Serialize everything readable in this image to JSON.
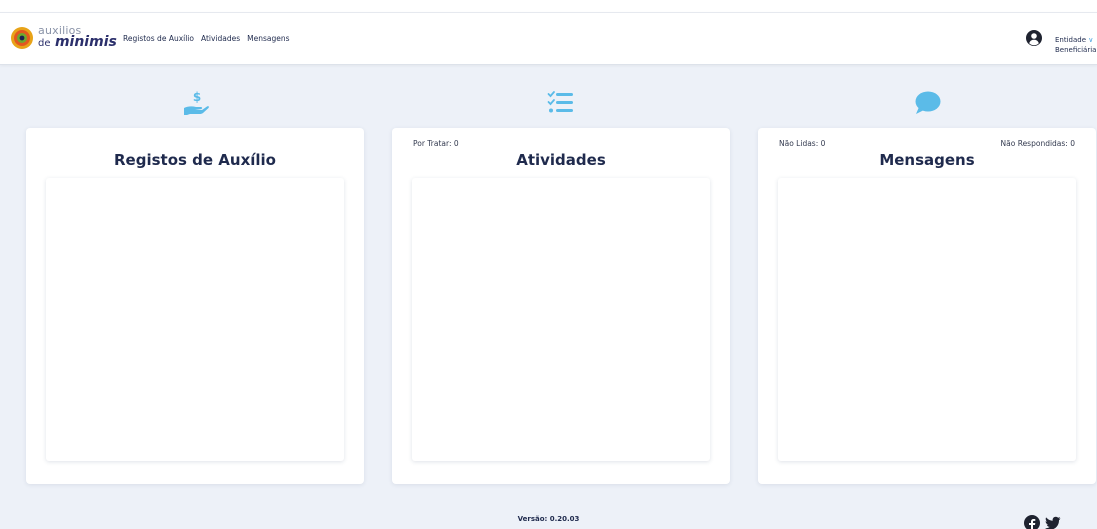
{
  "logo": {
    "small": "auxilios",
    "de": "de",
    "big": "minimis"
  },
  "nav": {
    "items": [
      "Registos de Auxílio",
      "Atividades",
      "Mensagens"
    ]
  },
  "user": {
    "role_line1": "Entidade",
    "chevron": "∨",
    "role_line2": "Beneficiária"
  },
  "cards": {
    "registos": {
      "title": "Registos de Auxílio"
    },
    "atividades": {
      "title": "Atividades",
      "por_tratar": "Por Tratar: 0"
    },
    "mensagens": {
      "title": "Mensagens",
      "nao_lidas": "Não Lidas: 0",
      "nao_respondidas": "Não Respondidas: 0"
    }
  },
  "icons": {
    "registos": "hand-dollar-icon",
    "atividades": "checklist-icon",
    "mensagens": "chat-bubble-icon",
    "user": "user-circle-icon",
    "facebook": "facebook-icon",
    "twitter": "twitter-icon"
  },
  "colors": {
    "accent": "#5bbbe8",
    "text": "#1f2a4d",
    "background": "#edf1f8"
  },
  "footer": {
    "version": "Versão: 0.20.03"
  }
}
